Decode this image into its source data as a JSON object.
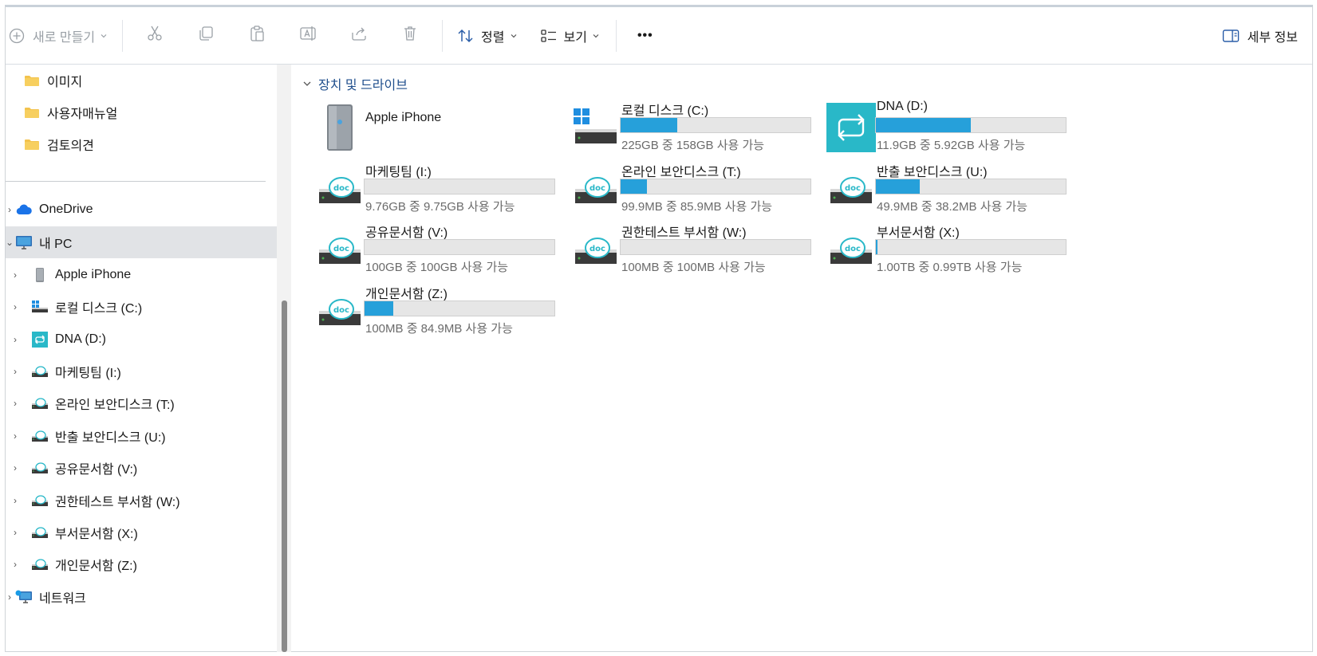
{
  "toolbar": {
    "new_label": "새로 만들기",
    "sort_label": "정렬",
    "view_label": "보기",
    "more_label": "•••",
    "details_label": "세부 정보",
    "icons": [
      "plus-circle-icon",
      "cut-icon",
      "copy-icon",
      "paste-icon",
      "rename-icon",
      "share-icon",
      "delete-icon",
      "sort-icon",
      "view-icon",
      "more-icon",
      "details-pane-icon"
    ]
  },
  "sidebar": {
    "folders": [
      {
        "label": "이미지"
      },
      {
        "label": "사용자매뉴얼"
      },
      {
        "label": "검토의견"
      }
    ],
    "onedrive": "OneDrive",
    "this_pc": "내 PC",
    "pc_children": [
      {
        "label": "Apple iPhone",
        "icon": "phone-icon"
      },
      {
        "label": "로컬 디스크 (C:)",
        "icon": "windows-drive-icon"
      },
      {
        "label": "DNA (D:)",
        "icon": "sync-drive-icon"
      },
      {
        "label": "마케팅팀 (I:)",
        "icon": "doc-drive-icon"
      },
      {
        "label": "온라인 보안디스크 (T:)",
        "icon": "doc-drive-icon"
      },
      {
        "label": "반출 보안디스크 (U:)",
        "icon": "doc-drive-icon"
      },
      {
        "label": "공유문서함 (V:)",
        "icon": "doc-drive-icon"
      },
      {
        "label": "권한테스트 부서함 (W:)",
        "icon": "doc-drive-icon"
      },
      {
        "label": "부서문서함 (X:)",
        "icon": "doc-drive-icon"
      },
      {
        "label": "개인문서함 (Z:)",
        "icon": "doc-drive-icon"
      }
    ],
    "network": "네트워크"
  },
  "main": {
    "section_title": "장치 및 드라이브",
    "drives": [
      {
        "name": "Apple iPhone",
        "type": "phone",
        "used_fraction": null,
        "info": ""
      },
      {
        "name": "로컬 디스크 (C:)",
        "type": "windows",
        "used_fraction": 0.3,
        "info": "225GB 중 158GB 사용 가능"
      },
      {
        "name": "DNA (D:)",
        "type": "sync",
        "used_fraction": 0.5,
        "info": "11.9GB 중 5.92GB 사용 가능"
      },
      {
        "name": "마케팅팀 (I:)",
        "type": "doc",
        "used_fraction": 0.0,
        "info": "9.76GB 중 9.75GB 사용 가능"
      },
      {
        "name": "온라인 보안디스크 (T:)",
        "type": "doc",
        "used_fraction": 0.14,
        "info": "99.9MB 중 85.9MB 사용 가능"
      },
      {
        "name": "반출 보안디스크 (U:)",
        "type": "doc",
        "used_fraction": 0.23,
        "info": "49.9MB 중 38.2MB 사용 가능"
      },
      {
        "name": "공유문서함 (V:)",
        "type": "doc",
        "used_fraction": 0.0,
        "info": "100GB 중 100GB 사용 가능"
      },
      {
        "name": "권한테스트 부서함 (W:)",
        "type": "doc",
        "used_fraction": 0.0,
        "info": "100MB 중 100MB 사용 가능"
      },
      {
        "name": "부서문서함 (X:)",
        "type": "doc",
        "used_fraction": 0.01,
        "info": "1.00TB 중 0.99TB 사용 가능"
      },
      {
        "name": "개인문서함 (Z:)",
        "type": "doc",
        "used_fraction": 0.15,
        "info": "100MB 중 84.9MB 사용 가능"
      }
    ]
  },
  "colors": {
    "accent": "#26a0da",
    "folder": "#f3c34d",
    "section_header": "#1f4e8c",
    "selected_bg": "#e1e3e6",
    "sync_drive": "#29b8c8"
  }
}
